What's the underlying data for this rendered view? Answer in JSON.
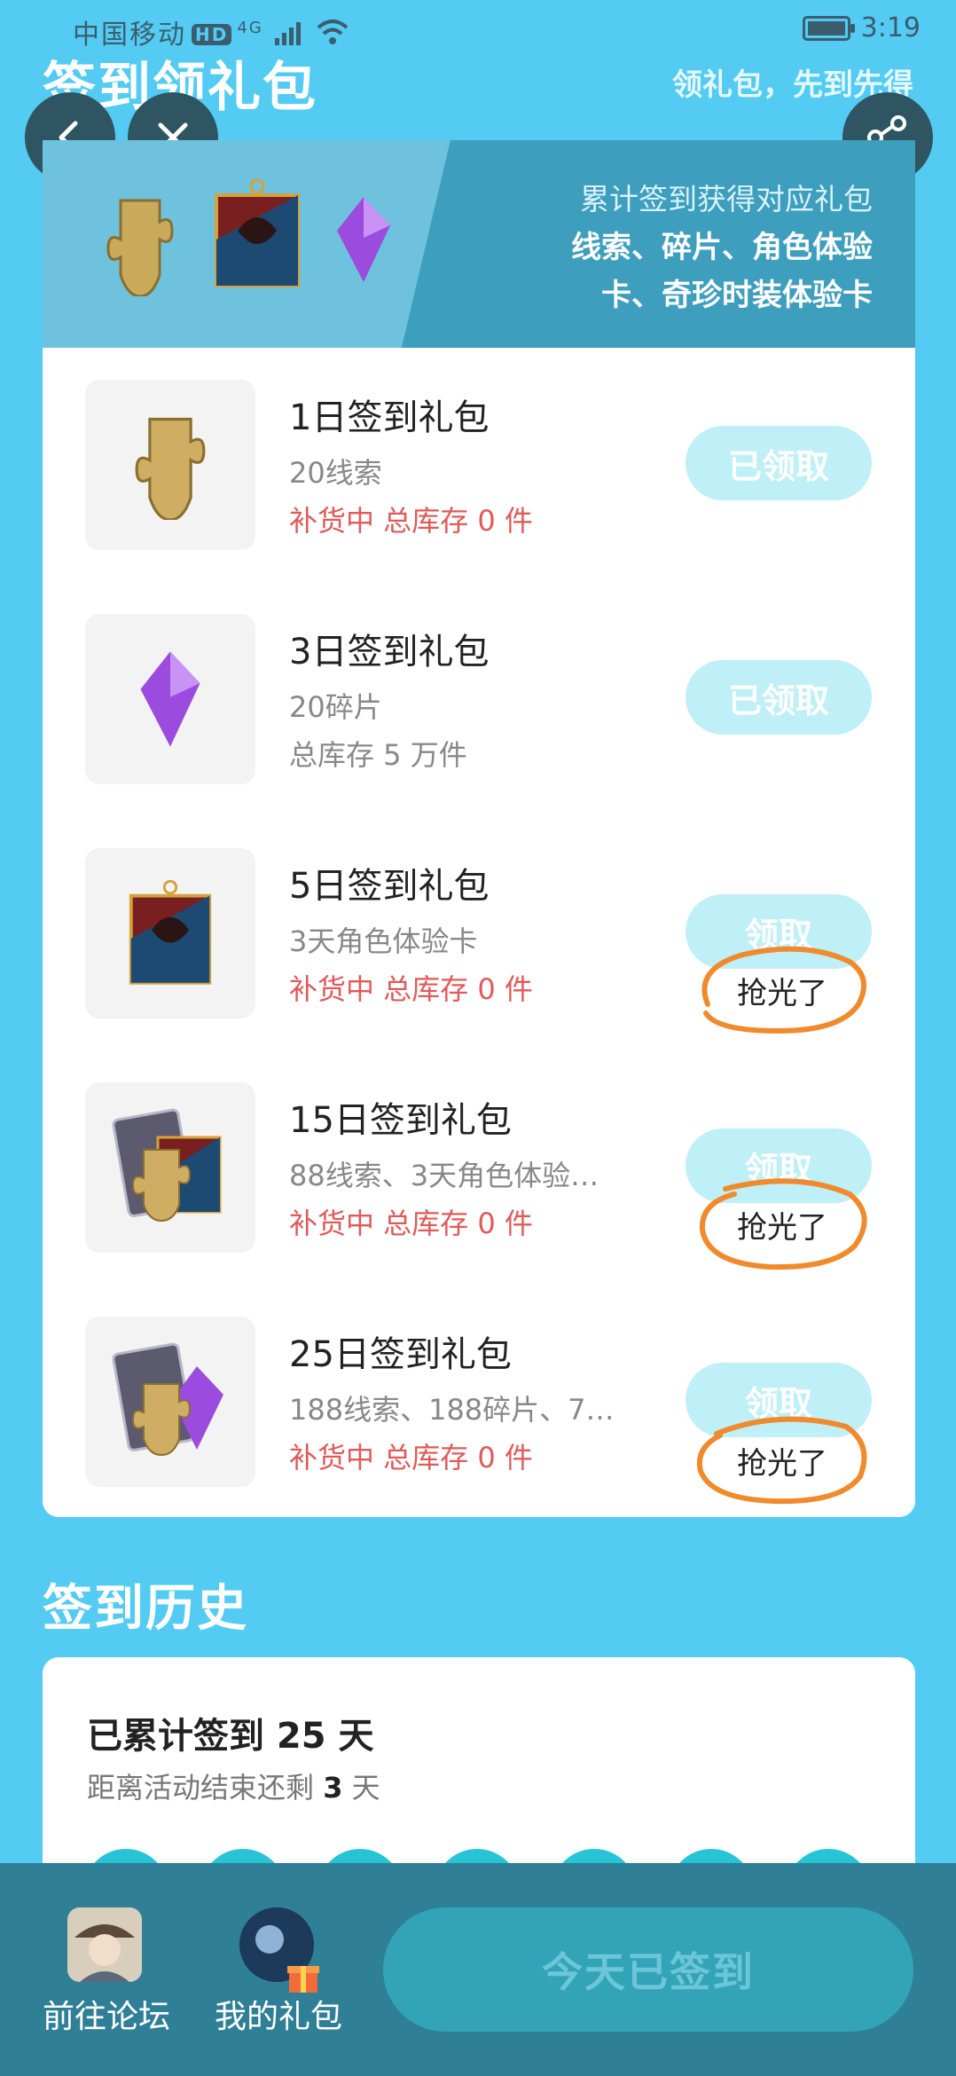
{
  "status_bar": {
    "carrier": "中国移动",
    "hd": "HD",
    "network": "4G",
    "time": "3:19"
  },
  "header": {
    "title": "签到领礼包",
    "slogan": "领礼包，先到先得"
  },
  "banner": {
    "description": "累计签到获得对应礼包",
    "line1": "线索、碎片、角色体验",
    "line2": "卡、奇珍时装体验卡"
  },
  "gifts": [
    {
      "name": "1日签到礼包",
      "desc": "20线索",
      "stock": "补货中 总库存 0 件",
      "button": "已领取",
      "icon": "puzzle-icon"
    },
    {
      "name": "3日签到礼包",
      "desc": "20碎片",
      "stock": "总库存 5 万件",
      "button": "已领取",
      "icon": "crystal-icon"
    },
    {
      "name": "5日签到礼包",
      "desc": "3天角色体验卡",
      "stock": "补货中 总库存 0 件",
      "button": "领取",
      "icon": "character-card-icon",
      "annotation": "抢光了"
    },
    {
      "name": "15日签到礼包",
      "desc": "88线索、3天角色体验…",
      "stock": "补货中 总库存 0 件",
      "button": "领取",
      "icon": "card-bundle-icon",
      "annotation": "抢光了"
    },
    {
      "name": "25日签到礼包",
      "desc": "188线索、188碎片、7…",
      "stock": "补货中 总库存 0 件",
      "button": "领取",
      "icon": "card-crystal-bundle-icon",
      "annotation": "抢光了"
    }
  ],
  "history": {
    "title": "签到历史",
    "total": "已累计签到 25 天",
    "remain_prefix": "距离活动结束还剩",
    "remain_days": "3",
    "remain_suffix": "天"
  },
  "bottom_bar": {
    "forum_label": "前往论坛",
    "gifts_label": "我的礼包",
    "signed_label": "今天已签到"
  },
  "colors": {
    "background": "#53cbf3",
    "button_disabled": "#bfeff7",
    "stock_red": "#e05a5a",
    "annotation_orange": "#f08a2c",
    "bottom_bar": "#2f7f97"
  }
}
